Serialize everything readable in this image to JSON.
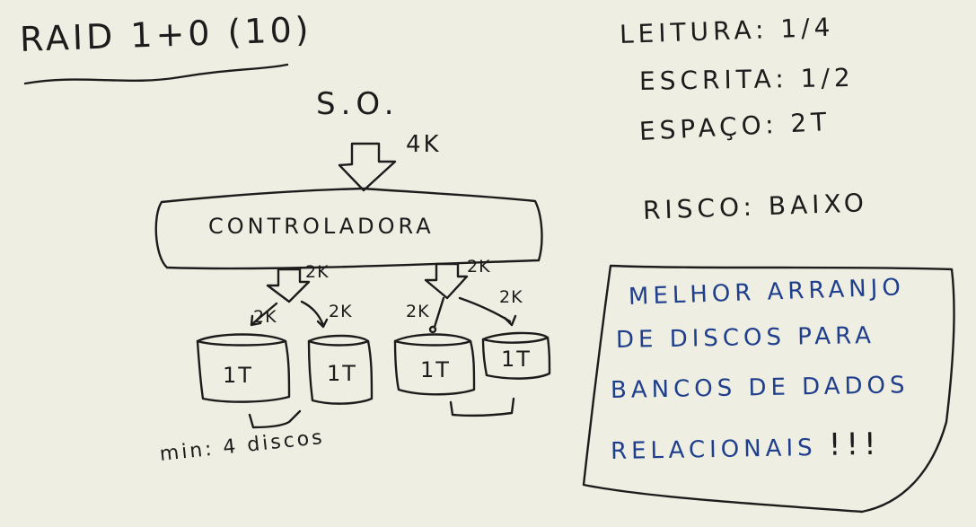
{
  "title": "RAID 1+0 (10)",
  "os_label": "S.O.",
  "io_size": "4K",
  "controller_label": "CONTROLADORA",
  "mirror_split": [
    "2K",
    "2K"
  ],
  "stripe_labels": [
    "2K",
    "2K",
    "2K",
    "2K"
  ],
  "disks": [
    "1T",
    "1T",
    "1T",
    "1T"
  ],
  "min_disks_note": "min: 4 discos",
  "stats": {
    "leitura": "LEITURA: 1/4",
    "escrita": "ESCRITA: 1/2",
    "espaco": "ESPAÇO: 2T",
    "risco": "RISCO: BAIXO"
  },
  "note": {
    "line1": "MELHOR ARRANJO",
    "line2": "DE DISCOS PARA",
    "line3": "BANCOS DE DADOS",
    "line4": "RELACIONAIS",
    "emphasis": "!!!",
    "color": "#1f3f8c"
  },
  "colors": {
    "paper": "#efeee2",
    "ink": "#1c1c1c",
    "note_ink": "#1f3f8c"
  }
}
